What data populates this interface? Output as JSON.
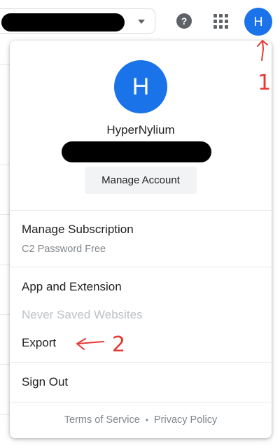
{
  "topbar": {
    "avatar_initial": "H",
    "help_glyph": "?",
    "icons": [
      "chevron-down-icon",
      "help-icon",
      "apps-grid-icon"
    ]
  },
  "profile": {
    "avatar_initial": "H",
    "name": "HyperNylium",
    "manage_account_label": "Manage Account"
  },
  "menu": {
    "subscription_label": "Manage Subscription",
    "plan_text": "C2 Password Free",
    "app_extension_label": "App and Extension",
    "never_saved_label": "Never Saved Websites",
    "export_label": "Export",
    "sign_out_label": "Sign Out"
  },
  "footer": {
    "terms_label": "Terms of Service",
    "separator": "•",
    "privacy_label": "Privacy Policy"
  },
  "annotations": {
    "label_1": "1",
    "label_2": "2",
    "color": "#e53935"
  },
  "colors": {
    "accent": "#1a73e8",
    "text": "#202124",
    "muted": "#80868b",
    "disabled": "#bdc1c6"
  }
}
